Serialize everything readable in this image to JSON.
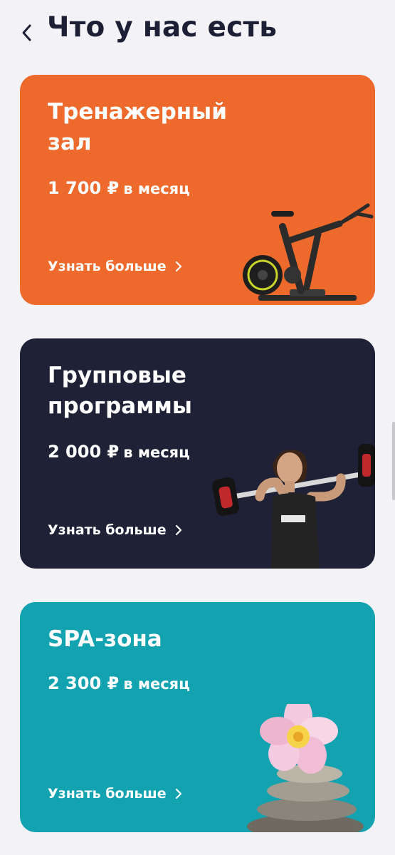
{
  "header": {
    "title": "Что у нас есть",
    "back_icon": "chevron-left-icon"
  },
  "cards": [
    {
      "title_lines": [
        "Тренажерный",
        "зал"
      ],
      "price": "1 700 ₽",
      "price_unit": "в месяц",
      "link_label": "Узнать больше",
      "background_color": "#ed6a2c",
      "illustration": "exercise-bike-icon"
    },
    {
      "title_lines": [
        "Групповые",
        "программы"
      ],
      "price": "2 000 ₽",
      "price_unit": "в месяц",
      "link_label": "Узнать больше",
      "background_color": "#1f2136",
      "illustration": "woman-barbell-icon"
    },
    {
      "title_lines": [
        "SPA-зона"
      ],
      "price": "2 300 ₽",
      "price_unit": "в месяц",
      "link_label": "Узнать больше",
      "background_color": "#12a2b0",
      "illustration": "spa-stones-flower-icon"
    }
  ],
  "colors": {
    "page_background": "#f2f2f7",
    "title_text": "#1d2035",
    "card_text": "#ffffff"
  }
}
